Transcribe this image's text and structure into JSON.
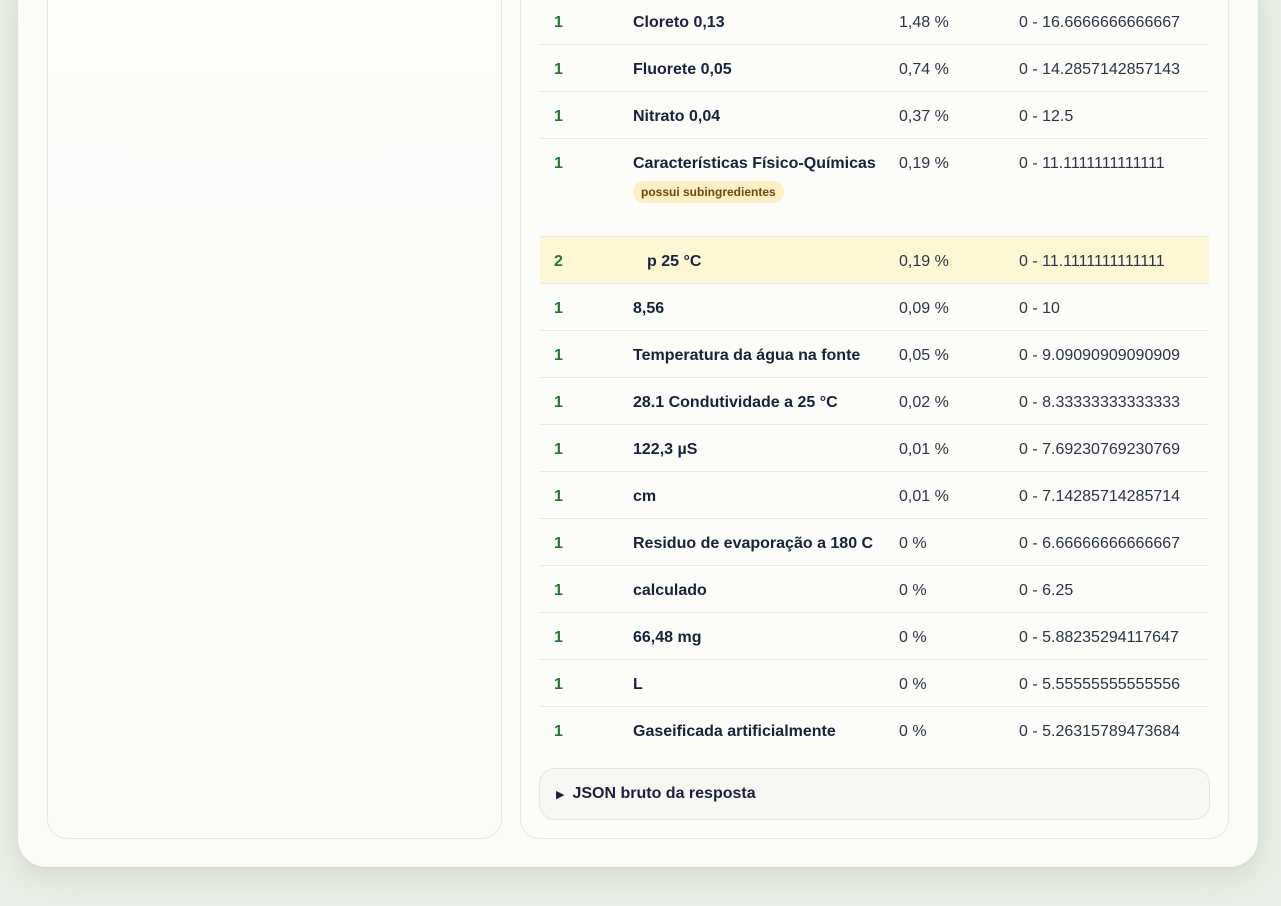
{
  "table": {
    "rows": [
      {
        "level": "1",
        "name": "Cloreto 0,13",
        "pct": "1,48 %",
        "range": "0 - 16.6666666666667"
      },
      {
        "level": "1",
        "name": "Fluorete 0,05",
        "pct": "0,74 %",
        "range": "0 - 14.2857142857143"
      },
      {
        "level": "1",
        "name": "Nitrato 0,04",
        "pct": "0,37 %",
        "range": "0 - 12.5"
      },
      {
        "level": "1",
        "name": "Características Físico-Químicas",
        "pct": "0,19 %",
        "range": "0 - 11.1111111111111",
        "badge": "possui subingredientes"
      },
      {
        "level": "2",
        "name": "p 25 °C",
        "pct": "0,19 %",
        "range": "0 - 11.1111111111111"
      },
      {
        "level": "1",
        "name": "8,56",
        "pct": "0,09 %",
        "range": "0 - 10"
      },
      {
        "level": "1",
        "name": "Temperatura da água na fonte",
        "pct": "0,05 %",
        "range": "0 - 9.09090909090909"
      },
      {
        "level": "1",
        "name": "28.1 Condutividade a 25 °C",
        "pct": "0,02 %",
        "range": "0 - 8.33333333333333"
      },
      {
        "level": "1",
        "name": "122,3 µS",
        "pct": "0,01 %",
        "range": "0 - 7.69230769230769"
      },
      {
        "level": "1",
        "name": "cm",
        "pct": "0,01 %",
        "range": "0 - 7.14285714285714"
      },
      {
        "level": "1",
        "name": "Residuo de evaporação a 180 C",
        "pct": "0 %",
        "range": "0 - 6.66666666666667"
      },
      {
        "level": "1",
        "name": "calculado",
        "pct": "0 %",
        "range": "0 - 6.25"
      },
      {
        "level": "1",
        "name": "66,48 mg",
        "pct": "0 %",
        "range": "0 - 5.88235294117647"
      },
      {
        "level": "1",
        "name": "L",
        "pct": "0 %",
        "range": "0 - 5.55555555555556"
      },
      {
        "level": "1",
        "name": "Gaseificada artificialmente",
        "pct": "0 %",
        "range": "0 - 5.26315789473684"
      }
    ]
  },
  "details": {
    "toggle_icon": "triangle-right-icon",
    "label": "JSON bruto da resposta"
  },
  "colors": {
    "level_green": "#1f7a33",
    "highlight_row": "#fdf7d4",
    "badge_bg": "#fcefc6"
  }
}
